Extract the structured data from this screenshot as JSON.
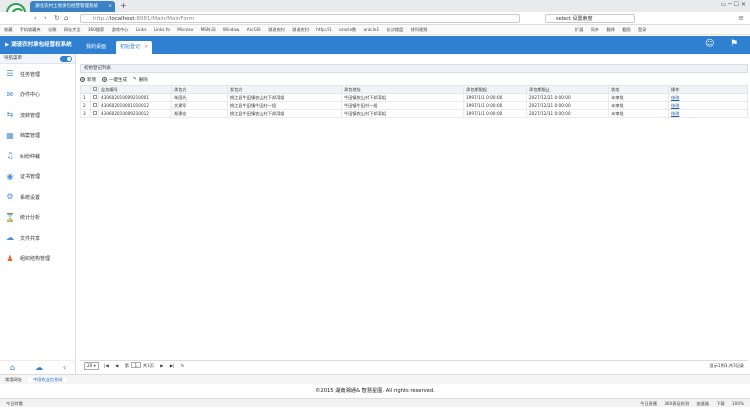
{
  "browser": {
    "tab_title": "湖北农村土地承包经营管理系统",
    "url_scheme": "http://",
    "url_host": "localhost",
    "url_rest": ":8081/Main/MainForm",
    "search_text": "select 设置索度",
    "bookmarks": [
      "收藏",
      "手机收藏夹",
      "谷歌",
      "网址大全",
      "360搜索",
      "游戏中心",
      "Links",
      "Links fo",
      "Microso",
      "MSN 网",
      "Window",
      "ArcGIS",
      "湖退农村",
      "湖退农村",
      "http://1",
      "oracle数",
      "oracle1",
      "长沙楼盘",
      "排列视频"
    ],
    "ext_labels": [
      "扩展",
      "同乡",
      "翻译",
      "截图",
      "登录"
    ]
  },
  "app": {
    "title": "湖退农村承包经营权系统",
    "tabs": [
      {
        "label": "我的桌面",
        "active": false
      },
      {
        "label": "初始登记",
        "active": true
      }
    ]
  },
  "sidebar": {
    "header": "导航菜单",
    "items": [
      {
        "label": "任务管理",
        "icon": "list-icon"
      },
      {
        "label": "办件中心",
        "icon": "mail-icon"
      },
      {
        "label": "流转管理",
        "icon": "flow-icon"
      },
      {
        "label": "档案管理",
        "icon": "archive-icon"
      },
      {
        "label": "纠纷仲裁",
        "icon": "bell-icon"
      },
      {
        "label": "证书管理",
        "icon": "certificate-icon"
      },
      {
        "label": "系统设置",
        "icon": "settings-icon"
      },
      {
        "label": "统计分析",
        "icon": "hourglass-icon"
      },
      {
        "label": "文件共享",
        "icon": "cloud-icon"
      },
      {
        "label": "组织结构管理",
        "icon": "users-icon"
      }
    ]
  },
  "main": {
    "panel_title": "初始登记列表",
    "toolbar": {
      "add": "新增",
      "generate": "一键生成",
      "delete": "删除"
    },
    "columns": [
      "业务编号",
      "承包方",
      "发包方",
      "承包地址",
      "承包期限起",
      "承包期限止",
      "状态",
      "操作"
    ],
    "rows": [
      {
        "no": "1",
        "id": "430602010009210001",
        "contractor": "朱国光",
        "issuer": "桃江县牛田镇农山村下邦湾组",
        "address": "牛田镇农山村下邦湾组",
        "start": "1997/1/1 0:00:00",
        "end": "2027/12/31 0:00:00",
        "status": "未审批",
        "action": "修改"
      },
      {
        "no": "2",
        "id": "430602010001010012",
        "contractor": "文建军",
        "issuer": "桃江县牛田镇牛田村一组",
        "address": "牛田镇牛田村一组",
        "start": "1997/1/1 0:00:00",
        "end": "2027/12/31 0:00:00",
        "status": "未审批",
        "action": "修改"
      },
      {
        "no": "3",
        "id": "430602010009210012",
        "contractor": "郑建宏",
        "issuer": "桃江县牛田镇农山村下邦湾组",
        "address": "牛田镇农山村下邦湾组",
        "start": "1997/1/1 0:00:00",
        "end": "2027/12/31 0:00:00",
        "status": "未审批",
        "action": "修改"
      }
    ],
    "pager": {
      "page_size": "20",
      "page_label": "第",
      "page": "1",
      "of_pages": "共1页",
      "summary": "显示1到3,共3记录"
    }
  },
  "bottom_tabs": [
    "常用网址",
    "中国农业信息网"
  ],
  "footer": "©2015 湖南湘通& 智慧星图. All rights reserved.",
  "statusbar": {
    "left": "今日特惠",
    "right": [
      "今日直播",
      "360表征检测",
      "加速器",
      "下载",
      "100%"
    ]
  }
}
